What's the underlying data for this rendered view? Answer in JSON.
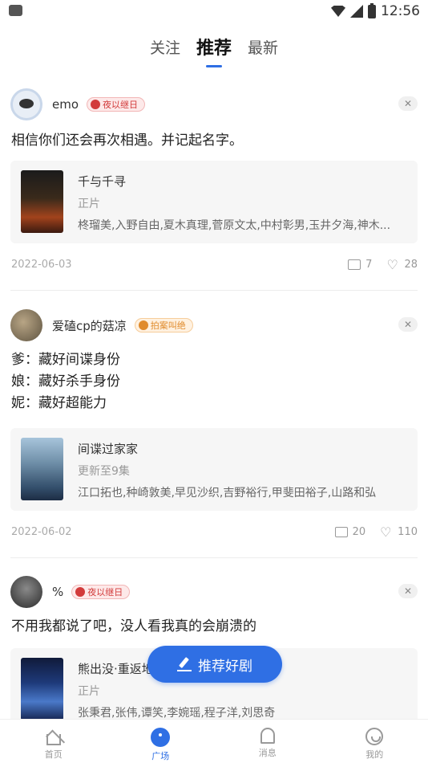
{
  "status_bar": {
    "time": "12:56"
  },
  "top_tabs": [
    {
      "label": "关注",
      "active": false
    },
    {
      "label": "推荐",
      "active": true
    },
    {
      "label": "最新",
      "active": false
    }
  ],
  "posts": [
    {
      "username": "emo",
      "badge": "夜以继日",
      "text": [
        "相信你们还会再次相遇。并记起名字。"
      ],
      "show": {
        "title": "千与千寻",
        "status": "正片",
        "cast": "柊瑠美,入野自由,夏木真理,菅原文太,中村彰男,玉井夕海,神木..."
      },
      "date": "2022-06-03",
      "comments": "7",
      "likes": "28"
    },
    {
      "username": "爱磕cp的菇凉",
      "badge": "拍案叫绝",
      "text": [
        "爹：藏好间谍身份",
        "娘：藏好杀手身份",
        "妮：藏好超能力"
      ],
      "show": {
        "title": "间谍过家家",
        "status": "更新至9集",
        "cast": "江口拓也,种崎敦美,早见沙织,吉野裕行,甲斐田裕子,山路和弘"
      },
      "date": "2022-06-02",
      "comments": "20",
      "likes": "110"
    },
    {
      "username": "%",
      "badge": "夜以继日",
      "text": [
        "不用我都说了吧，没人看我真的会崩溃的"
      ],
      "show": {
        "title": "熊出没·重返地",
        "status": "正片",
        "cast": "张秉君,张伟,谭笑,李婉瑶,程子洋,刘思奇"
      }
    }
  ],
  "fab": {
    "label": "推荐好剧"
  },
  "bottom_nav": [
    {
      "label": "首页",
      "icon": "home-icon",
      "active": false
    },
    {
      "label": "广场",
      "icon": "plaza-icon",
      "active": true
    },
    {
      "label": "消息",
      "icon": "bell-icon",
      "active": false
    },
    {
      "label": "我的",
      "icon": "profile-icon",
      "active": false
    }
  ],
  "colors": {
    "accent": "#2f6fe4",
    "badge_red": "#d23b3b",
    "badge_orange": "#e08b2c"
  }
}
